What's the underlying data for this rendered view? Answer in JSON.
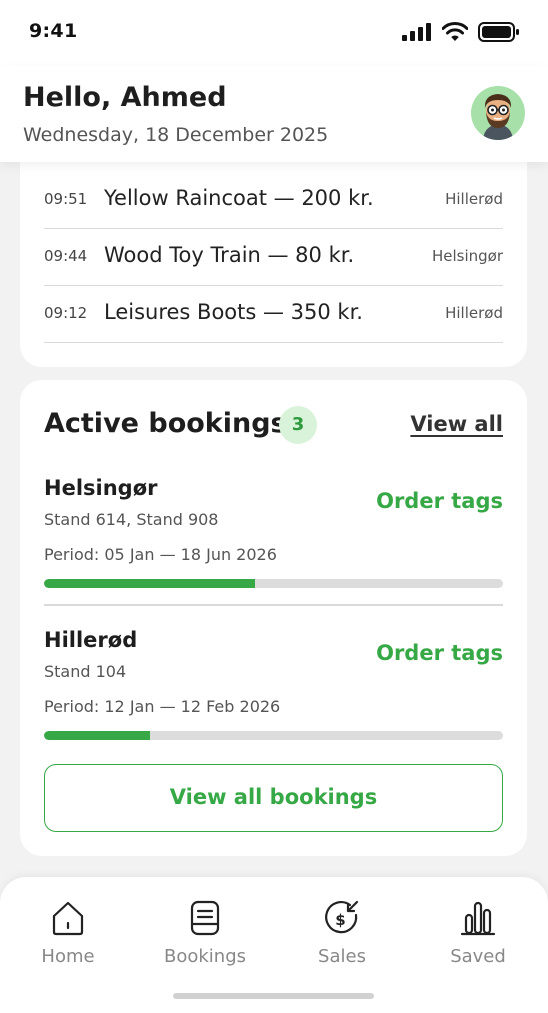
{
  "status": {
    "time": "9:41"
  },
  "header": {
    "greeting": "Hello, Ahmed",
    "date": "Wednesday, 18 December 2025"
  },
  "sales": [
    {
      "time": "09:51",
      "title": "Yellow Raincoat — 200 kr.",
      "location": "Hillerød"
    },
    {
      "time": "09:44",
      "title": "Wood Toy Train — 80 kr.",
      "location": "Helsingør"
    },
    {
      "time": "09:12",
      "title": "Leisures Boots — 350 kr.",
      "location": "Hillerød"
    }
  ],
  "bookings": {
    "title": "Active bookings",
    "count": "3",
    "view_all_label": "View all",
    "items": [
      {
        "name": "Helsingør",
        "stands": "Stand 614, Stand 908",
        "period": "Period: 05 Jan — 18 Jun 2026",
        "action": "Order tags",
        "progress": 0.46
      },
      {
        "name": "Hillerød",
        "stands": "Stand 104",
        "period": "Period: 12 Jan — 12 Feb 2026",
        "action": "Order tags",
        "progress": 0.23
      }
    ],
    "view_all_bookings_label": "View all bookings"
  },
  "tabs": [
    {
      "label": "Home",
      "icon": "home-icon"
    },
    {
      "label": "Bookings",
      "icon": "bookings-icon"
    },
    {
      "label": "Sales",
      "icon": "sales-icon"
    },
    {
      "label": "Saved",
      "icon": "saved-icon"
    }
  ],
  "colors": {
    "accent": "#36a845",
    "badge_bg": "#d9f3da",
    "avatar_bg": "#a7e0a9"
  }
}
